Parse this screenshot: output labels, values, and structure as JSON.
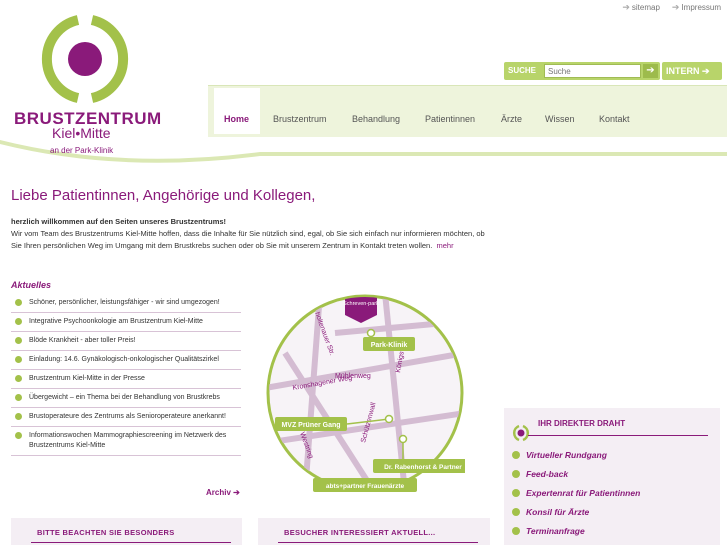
{
  "toplinks": {
    "sitemap": "sitemap",
    "impressum": "Impressum"
  },
  "logo": {
    "line1": "BRUSTZENTRUM",
    "line2": "Kiel•Mitte",
    "line3": "an der Park-Klinik"
  },
  "search": {
    "label": "SUCHE",
    "placeholder": "Suche",
    "go": "➔"
  },
  "intern": {
    "label": "INTERN ➔"
  },
  "nav": {
    "items": [
      "Home",
      "Brustzentrum",
      "Behandlung",
      "Patientinnen",
      "Ärzte",
      "Wissen",
      "Kontakt"
    ]
  },
  "main": {
    "title": "Liebe Patientinnen, Angehörige und Kollegen,",
    "intro_bold": "herzlich willkommen auf den Seiten unseres Brustzentrums!",
    "intro_text": "Wir vom Team des Brustzentrums Kiel-Mitte hoffen, dass die Inhalte für Sie nützlich sind, egal, ob Sie sich einfach nur informieren möchten, ob Sie Ihren persönlichen Weg im Umgang mit dem Brustkrebs suchen oder ob Sie mit unserem Zentrum in Kontakt treten wollen.",
    "mehr": "mehr"
  },
  "aktuelles": {
    "title": "Aktuelles",
    "items": [
      "Schöner, persönlicher, leistungsfähiger - wir sind umgezogen!",
      "Integrative Psychoonkologie am Brustzentrum Kiel-Mitte",
      "Blöde Krankheit - aber toller Preis!",
      "Einladung: 14.6. Gynäkologisch-onkologischer Qualitätszirkel",
      "Brustzentrum Kiel-Mitte in der Presse",
      "Übergewicht – ein Thema bei der Behandlung von Brustkrebs",
      "Brustoperateure des Zentrums als Senioroperateure anerkannt!",
      "Informationswochen Mammographiescreening im Netzwerk des Brustzentrums Kiel-Mitte"
    ],
    "archiv": "Archiv"
  },
  "map": {
    "labels": {
      "schreven": "Schreven-park",
      "parkklinik": "Park-Klinik",
      "mvz": "MVZ Prüner Gang",
      "rabenhorst": "Dr. Rabenhorst & Partner",
      "abts": "abts+partner Frauenärzte"
    },
    "streets": {
      "kronshagener": "Kronshagener Weg",
      "schuetzenwall": "Schützenwall",
      "westring": "Westring",
      "holstenbruecke": "holtenauer Str.",
      "koenigsweg": "Königsweg",
      "muehlen": "Mühlenweg"
    }
  },
  "draht": {
    "title": "IHR DIREKTER DRAHT",
    "items": [
      "Virtueller Rundgang",
      "Feed-back",
      "Expertenrat für Patientinnen",
      "Konsil für Ärzte",
      "Terminanfrage"
    ]
  },
  "boxes": {
    "box1": "BITTE BEACHTEN SIE BESONDERS",
    "box2": "BESUCHER INTERESSIERT AKTUELL..."
  },
  "colors": {
    "brand": "#8a1a7a",
    "accent": "#a3c14a",
    "navbg": "#eef4dc"
  }
}
